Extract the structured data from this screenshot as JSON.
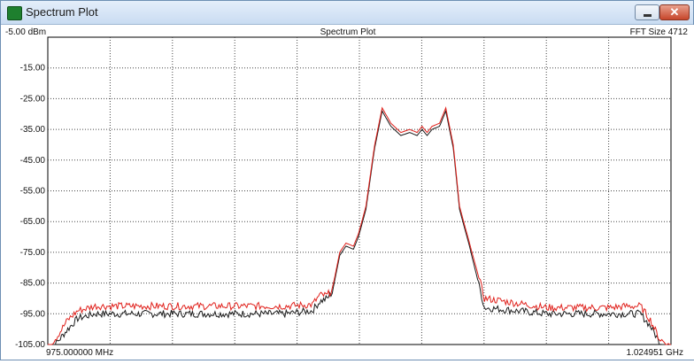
{
  "window": {
    "title": "Spectrum Plot",
    "minimize_glyph": "",
    "close_glyph": "✕"
  },
  "chart_data": {
    "type": "line",
    "title": "Spectrum Plot",
    "top_left_label": "-5.00 dBm",
    "top_right_label": "FFT Size 4712",
    "x_start_label": "975.000000 MHz",
    "x_end_label": "1.024951 GHz",
    "x_unit": "MHz",
    "xlim": [
      975.0,
      1024.951
    ],
    "ylim": [
      -105,
      -5
    ],
    "y_ticks": [
      "-15.00",
      "-25.00",
      "-35.00",
      "-45.00",
      "-55.00",
      "-65.00",
      "-75.00",
      "-85.00",
      "-95.00",
      "-105.00"
    ],
    "y_tick_values": [
      -15,
      -25,
      -35,
      -45,
      -55,
      -65,
      -75,
      -85,
      -95,
      -105
    ],
    "grid": true,
    "x_grid_count": 9,
    "series": [
      {
        "color": "#e0201b",
        "x": [
          975.0,
          975.8,
          976.6,
          977.4,
          978.8,
          981,
          985,
          990,
          994,
          996.2,
          996.8,
          997.4,
          997.8,
          998.4,
          998.9,
          999.5,
          999.9,
          1000.5,
          1001.2,
          1001.8,
          1002.5,
          1003.3,
          1004.0,
          1004.6,
          1005.0,
          1005.4,
          1005.8,
          1006.4,
          1006.9,
          1007.5,
          1008.0,
          1008.8,
          1010,
          1015,
          1020,
          1021.5,
          1022.5,
          1023.3,
          1024.0,
          1024.951
        ],
        "y": [
          -106,
          -102,
          -97,
          -94,
          -92.5,
          -92.5,
          -92.5,
          -92.5,
          -92.5,
          -92,
          -89,
          -89,
          -87,
          -75,
          -72,
          -73,
          -69,
          -60,
          -40,
          -28,
          -33,
          -36,
          -35,
          -36,
          -34,
          -36,
          -34,
          -33,
          -28,
          -40,
          -60,
          -72,
          -90,
          -93,
          -93,
          -92.5,
          -92.5,
          -97,
          -103,
          -106
        ]
      },
      {
        "color": "#1a1a1a",
        "x": [
          975.0,
          975.8,
          976.6,
          977.4,
          978.8,
          981,
          985,
          990,
          994,
          996.2,
          996.8,
          997.4,
          997.8,
          998.4,
          998.9,
          999.5,
          999.9,
          1000.5,
          1001.2,
          1001.8,
          1002.5,
          1003.3,
          1004.0,
          1004.6,
          1005.0,
          1005.4,
          1005.8,
          1006.4,
          1006.9,
          1007.5,
          1008.0,
          1008.8,
          1010,
          1015,
          1020,
          1021.5,
          1022.5,
          1023.3,
          1024.0,
          1024.951
        ],
        "y": [
          -107,
          -104,
          -100,
          -96.5,
          -95,
          -95,
          -95,
          -95,
          -95,
          -94,
          -91,
          -90,
          -88,
          -76,
          -73,
          -74,
          -70,
          -61,
          -41,
          -29,
          -34,
          -37,
          -36,
          -37,
          -35,
          -37,
          -35,
          -34,
          -29,
          -41,
          -61,
          -73,
          -93,
          -95,
          -95,
          -95,
          -95,
          -99,
          -104,
          -107
        ]
      }
    ]
  }
}
